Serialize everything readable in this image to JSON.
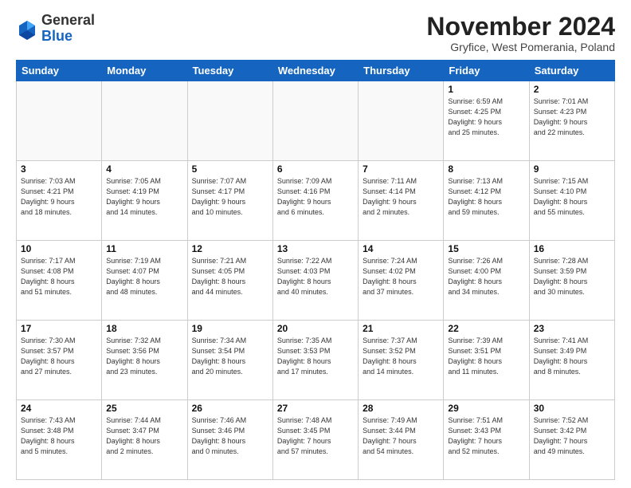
{
  "header": {
    "logo_general": "General",
    "logo_blue": "Blue",
    "month_title": "November 2024",
    "location": "Gryfice, West Pomerania, Poland"
  },
  "days_of_week": [
    "Sunday",
    "Monday",
    "Tuesday",
    "Wednesday",
    "Thursday",
    "Friday",
    "Saturday"
  ],
  "weeks": [
    [
      {
        "day": "",
        "info": ""
      },
      {
        "day": "",
        "info": ""
      },
      {
        "day": "",
        "info": ""
      },
      {
        "day": "",
        "info": ""
      },
      {
        "day": "",
        "info": ""
      },
      {
        "day": "1",
        "info": "Sunrise: 6:59 AM\nSunset: 4:25 PM\nDaylight: 9 hours\nand 25 minutes."
      },
      {
        "day": "2",
        "info": "Sunrise: 7:01 AM\nSunset: 4:23 PM\nDaylight: 9 hours\nand 22 minutes."
      }
    ],
    [
      {
        "day": "3",
        "info": "Sunrise: 7:03 AM\nSunset: 4:21 PM\nDaylight: 9 hours\nand 18 minutes."
      },
      {
        "day": "4",
        "info": "Sunrise: 7:05 AM\nSunset: 4:19 PM\nDaylight: 9 hours\nand 14 minutes."
      },
      {
        "day": "5",
        "info": "Sunrise: 7:07 AM\nSunset: 4:17 PM\nDaylight: 9 hours\nand 10 minutes."
      },
      {
        "day": "6",
        "info": "Sunrise: 7:09 AM\nSunset: 4:16 PM\nDaylight: 9 hours\nand 6 minutes."
      },
      {
        "day": "7",
        "info": "Sunrise: 7:11 AM\nSunset: 4:14 PM\nDaylight: 9 hours\nand 2 minutes."
      },
      {
        "day": "8",
        "info": "Sunrise: 7:13 AM\nSunset: 4:12 PM\nDaylight: 8 hours\nand 59 minutes."
      },
      {
        "day": "9",
        "info": "Sunrise: 7:15 AM\nSunset: 4:10 PM\nDaylight: 8 hours\nand 55 minutes."
      }
    ],
    [
      {
        "day": "10",
        "info": "Sunrise: 7:17 AM\nSunset: 4:08 PM\nDaylight: 8 hours\nand 51 minutes."
      },
      {
        "day": "11",
        "info": "Sunrise: 7:19 AM\nSunset: 4:07 PM\nDaylight: 8 hours\nand 48 minutes."
      },
      {
        "day": "12",
        "info": "Sunrise: 7:21 AM\nSunset: 4:05 PM\nDaylight: 8 hours\nand 44 minutes."
      },
      {
        "day": "13",
        "info": "Sunrise: 7:22 AM\nSunset: 4:03 PM\nDaylight: 8 hours\nand 40 minutes."
      },
      {
        "day": "14",
        "info": "Sunrise: 7:24 AM\nSunset: 4:02 PM\nDaylight: 8 hours\nand 37 minutes."
      },
      {
        "day": "15",
        "info": "Sunrise: 7:26 AM\nSunset: 4:00 PM\nDaylight: 8 hours\nand 34 minutes."
      },
      {
        "day": "16",
        "info": "Sunrise: 7:28 AM\nSunset: 3:59 PM\nDaylight: 8 hours\nand 30 minutes."
      }
    ],
    [
      {
        "day": "17",
        "info": "Sunrise: 7:30 AM\nSunset: 3:57 PM\nDaylight: 8 hours\nand 27 minutes."
      },
      {
        "day": "18",
        "info": "Sunrise: 7:32 AM\nSunset: 3:56 PM\nDaylight: 8 hours\nand 23 minutes."
      },
      {
        "day": "19",
        "info": "Sunrise: 7:34 AM\nSunset: 3:54 PM\nDaylight: 8 hours\nand 20 minutes."
      },
      {
        "day": "20",
        "info": "Sunrise: 7:35 AM\nSunset: 3:53 PM\nDaylight: 8 hours\nand 17 minutes."
      },
      {
        "day": "21",
        "info": "Sunrise: 7:37 AM\nSunset: 3:52 PM\nDaylight: 8 hours\nand 14 minutes."
      },
      {
        "day": "22",
        "info": "Sunrise: 7:39 AM\nSunset: 3:51 PM\nDaylight: 8 hours\nand 11 minutes."
      },
      {
        "day": "23",
        "info": "Sunrise: 7:41 AM\nSunset: 3:49 PM\nDaylight: 8 hours\nand 8 minutes."
      }
    ],
    [
      {
        "day": "24",
        "info": "Sunrise: 7:43 AM\nSunset: 3:48 PM\nDaylight: 8 hours\nand 5 minutes."
      },
      {
        "day": "25",
        "info": "Sunrise: 7:44 AM\nSunset: 3:47 PM\nDaylight: 8 hours\nand 2 minutes."
      },
      {
        "day": "26",
        "info": "Sunrise: 7:46 AM\nSunset: 3:46 PM\nDaylight: 8 hours\nand 0 minutes."
      },
      {
        "day": "27",
        "info": "Sunrise: 7:48 AM\nSunset: 3:45 PM\nDaylight: 7 hours\nand 57 minutes."
      },
      {
        "day": "28",
        "info": "Sunrise: 7:49 AM\nSunset: 3:44 PM\nDaylight: 7 hours\nand 54 minutes."
      },
      {
        "day": "29",
        "info": "Sunrise: 7:51 AM\nSunset: 3:43 PM\nDaylight: 7 hours\nand 52 minutes."
      },
      {
        "day": "30",
        "info": "Sunrise: 7:52 AM\nSunset: 3:42 PM\nDaylight: 7 hours\nand 49 minutes."
      }
    ]
  ]
}
